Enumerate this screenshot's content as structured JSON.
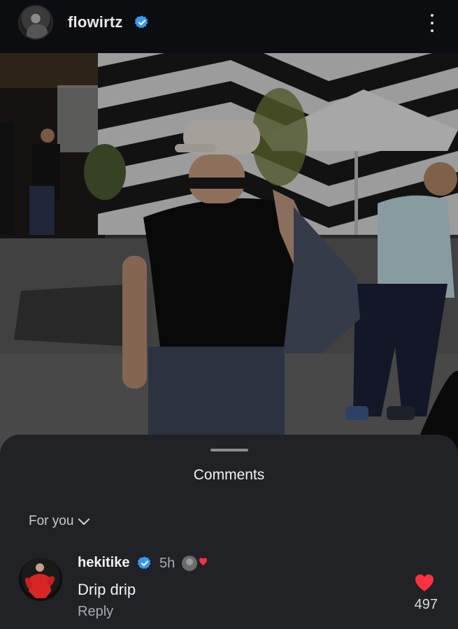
{
  "post": {
    "username": "flowirtz",
    "verified": true,
    "menu_icon": "more-vertical-icon"
  },
  "comments_sheet": {
    "title": "Comments",
    "filter_label": "For you",
    "filter_icon": "chevron-down-icon"
  },
  "comment": {
    "username": "hekitike",
    "verified": true,
    "time": "5h",
    "text": "Drip drip",
    "reply_label": "Reply",
    "like_count": "497",
    "liked_by_author": true
  },
  "colors": {
    "verified_blue": "#3897f0",
    "heart_red": "#ff3040",
    "sheet_bg": "#202226",
    "app_bg": "#0c0d10"
  }
}
